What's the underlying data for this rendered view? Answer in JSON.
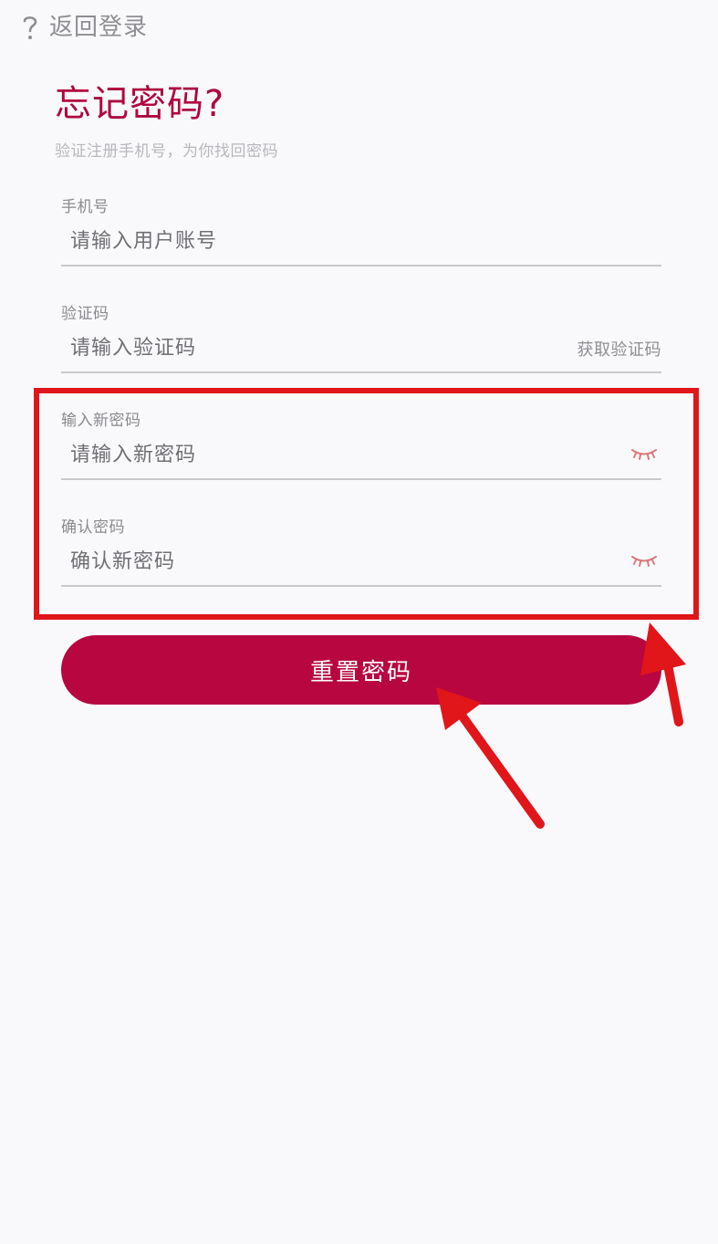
{
  "topbar": {
    "back_label": "返回登录",
    "back_icon": "question-mark-icon"
  },
  "header": {
    "title": "忘记密码?",
    "subtitle": "验证注册手机号，为你找回密码"
  },
  "form": {
    "phone": {
      "label": "手机号",
      "placeholder": "请输入用户账号"
    },
    "code": {
      "label": "验证码",
      "placeholder": "请输入验证码",
      "get_code_label": "获取验证码"
    },
    "new_password": {
      "label": "输入新密码",
      "placeholder": "请输入新密码",
      "toggle_icon": "eye-closed-icon"
    },
    "confirm_password": {
      "label": "确认密码",
      "placeholder": "确认新密码",
      "toggle_icon": "eye-closed-icon"
    },
    "submit_label": "重置密码"
  },
  "colors": {
    "brand": "#b80641",
    "title": "#b0063f",
    "annotation": "#e0161a",
    "eye_icon": "#d97a7a"
  }
}
